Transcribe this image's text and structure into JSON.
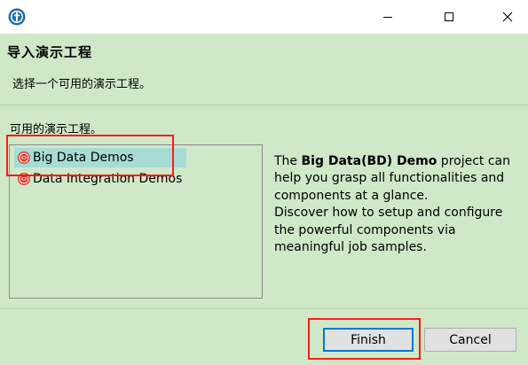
{
  "window": {
    "icons": {
      "app": "talend-logo-icon",
      "minimize": "minimize-icon",
      "maximize": "maximize-icon",
      "close": "close-icon"
    }
  },
  "header": {
    "title": "导入演示工程",
    "description": "选择一个可用的演示工程。"
  },
  "projects": {
    "label": "可用的演示工程。",
    "items": [
      {
        "label": "Big Data Demos",
        "icon": "demo-project-icon",
        "selected": true
      },
      {
        "label": "Data Integration Demos",
        "icon": "demo-project-icon",
        "selected": false
      }
    ]
  },
  "description_panel": {
    "intro": "The ",
    "highlight": "Big Data(BD) Demo",
    "rest": " project can help you grasp all functionalities and components at a glance.",
    "line2": "Discover how to setup and configure the powerful components via meaningful job samples."
  },
  "buttons": {
    "finish": "Finish",
    "cancel": "Cancel"
  },
  "colors": {
    "background": "#cfe8c8",
    "selection": "#a6dbd6",
    "highlight_box": "#ff1a1a",
    "default_button_border": "#0078d7"
  }
}
